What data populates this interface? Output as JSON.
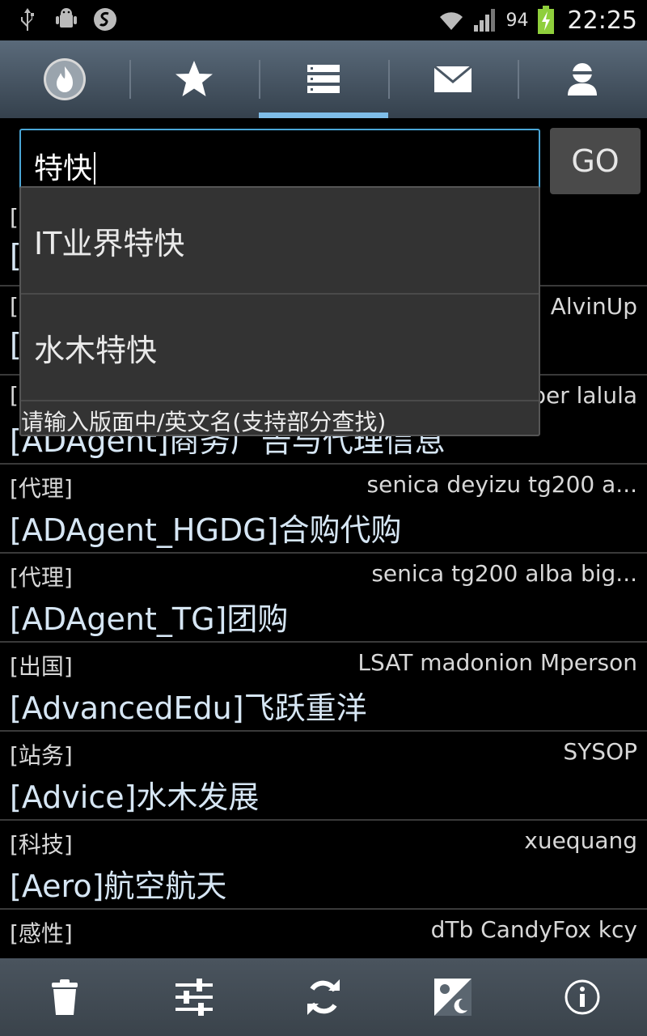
{
  "status_bar": {
    "battery_percent": "94",
    "time": "22:25",
    "icons": [
      "usb-icon",
      "android-debug-icon",
      "sync-icon",
      "wifi-icon",
      "signal-icon",
      "battery-charging-icon"
    ]
  },
  "tabs": [
    {
      "icon": "hot-icon",
      "active": false
    },
    {
      "icon": "star-icon",
      "active": false
    },
    {
      "icon": "boards-list-icon",
      "active": true
    },
    {
      "icon": "mail-icon",
      "active": false
    },
    {
      "icon": "user-icon",
      "active": false
    }
  ],
  "search": {
    "value": "特快",
    "go_label": "GO"
  },
  "dropdown": {
    "items": [
      "IT业界特快",
      "水木特快"
    ],
    "hint": "请输入版面中/英文名(支持部分查找)"
  },
  "boards": [
    {
      "category": "[",
      "moderators": "",
      "name": "["
    },
    {
      "category": "[",
      "moderators": "AlvinUp",
      "name": "["
    },
    {
      "category": "[",
      "moderators": "ber lalula",
      "name": "[ADAgent]商务广告与代理信息"
    },
    {
      "category": "[代理]",
      "moderators": "senica deyizu tg200 a...",
      "name": "[ADAgent_HGDG]合购代购"
    },
    {
      "category": "[代理]",
      "moderators": "senica tg200 alba big...",
      "name": "[ADAgent_TG]团购"
    },
    {
      "category": "[出国]",
      "moderators": "LSAT madonion Mperson",
      "name": "[AdvancedEdu]飞跃重洋"
    },
    {
      "category": "[站务]",
      "moderators": "SYSOP",
      "name": "[Advice]水木发展"
    },
    {
      "category": "[科技]",
      "moderators": "xuequang",
      "name": "[Aero]航空航天"
    },
    {
      "category": "[感性]",
      "moderators": "dTb CandyFox kcy",
      "name": ""
    }
  ],
  "bottom_bar": [
    "trash-icon",
    "settings-sliders-icon",
    "refresh-icon",
    "day-night-icon",
    "info-icon"
  ],
  "colors": {
    "accent": "#7fbde8",
    "input_border": "#4aa6d6",
    "board_name": "#d6e6f4"
  }
}
